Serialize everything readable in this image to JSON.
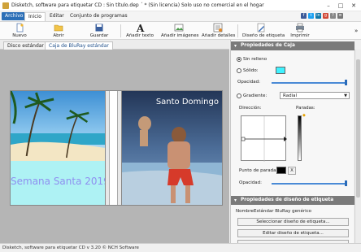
{
  "window": {
    "title": "Disketch, software para etiquetar CD : Sin título.dep ´ * (Sin licencia) Solo uso no comercial en el hogar"
  },
  "menu": {
    "file": "Archivo",
    "items": [
      "Inicio",
      "Editar",
      "Conjunto de programas"
    ]
  },
  "toolbar": {
    "new": "Nuevo",
    "open": "Abrir",
    "save": "Guardar",
    "add_text": "Añadir texto",
    "add_images": "Añadir imágenes",
    "add_details": "Añadir detalles",
    "label_design": "Diseño de etiqueta",
    "print": "Imprimir"
  },
  "tabs": [
    "Disco estándar",
    "Caja de BluRay estándar"
  ],
  "canvas": {
    "front_caption": "Semana Santa 2019",
    "back_title": "Santo Domingo"
  },
  "panel_box": {
    "header": "Propiedades de Caja",
    "no_fill": "Sin relleno",
    "solid": "Sólido:",
    "solid_color": "#3ff2ff",
    "opacity_label": "Opacidad:",
    "gradient": "Gradiente:",
    "gradient_type": "Radial",
    "direction_label": "Dirección:",
    "stops_label": "Paradas:",
    "stop_point_label": "Punto de parada:",
    "stop_color": "#000000",
    "stop_remove": "X",
    "opacity_label_2": "Opacidad:",
    "selected_fill": "no_fill"
  },
  "panel_design": {
    "header": "Propiedades de diseño de etiqueta",
    "name_label": "Nombre:",
    "name_value": "Estándar BluRay genérico",
    "select_button": "Seleccionar diseño de etiqueta...",
    "edit_button": "Editar diseño de etiqueta..."
  },
  "status": {
    "text": "Disketch, software para etiquetar CD v 3.20 © NCH Software"
  },
  "colors": {
    "accent": "#2c6fb7",
    "panel_header": "#7a7a7a",
    "caption_text": "#8f8ff0",
    "cyan_fill": "#aef2f4"
  }
}
